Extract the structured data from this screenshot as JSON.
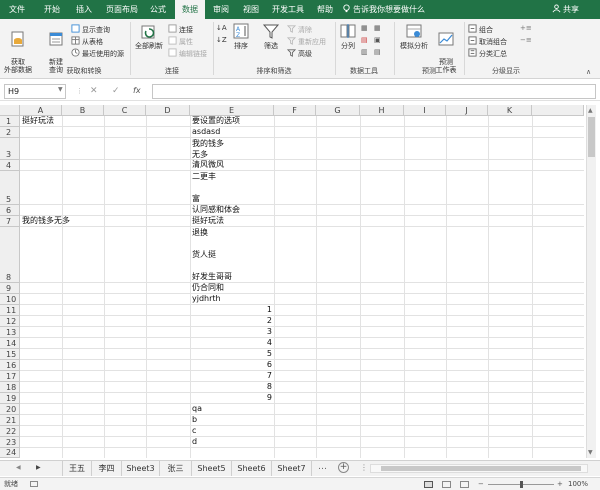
{
  "tabs": [
    "文件",
    "开始",
    "插入",
    "页面布局",
    "公式",
    "数据",
    "审阅",
    "视图",
    "开发工具",
    "帮助"
  ],
  "search_text": "告诉我你想要做什么",
  "share": "共享",
  "ribbon": {
    "get_external": "获取\n外部数据",
    "new_query": "新建\n查询",
    "show_queries": "显示查询",
    "from_table": "从表格",
    "recent_sources": "最近使用的源",
    "refresh_all": "全部刷新",
    "connections": "连接",
    "properties": "属性",
    "edit_links": "编辑链接",
    "sort": "排序",
    "filter": "筛选",
    "clear": "清除",
    "reapply": "重新应用",
    "advanced": "高级",
    "split": "分列",
    "whatif": "模拟分析",
    "forecast_sheet": "预测\n工作表",
    "group": "组合",
    "ungroup": "取消组合",
    "subtotal": "分类汇总",
    "groups": {
      "get_transform": "获取和转换",
      "connections": "连接",
      "sort_filter": "排序和筛选",
      "data_tools": "数据工具",
      "forecast": "预测",
      "outline": "分级显示"
    }
  },
  "name_box": "H9",
  "formula_icons": {
    "cancel": "✕",
    "enter": "✓",
    "fx": "fx"
  },
  "columns": [
    "A",
    "B",
    "C",
    "D",
    "E",
    "F",
    "G",
    "H",
    "I",
    "J",
    "K"
  ],
  "rows": [
    "1",
    "2",
    "3",
    "4",
    "5",
    "6",
    "7",
    "8",
    "9",
    "10",
    "11",
    "12",
    "13",
    "14",
    "15",
    "16",
    "17",
    "18",
    "19",
    "20",
    "21",
    "22",
    "23",
    "24"
  ],
  "cells": {
    "a1": "挺好玩法",
    "e1": "要设置的选项",
    "e2": "asdasd",
    "e3a": "我的钱多",
    "e3b": "无多",
    "e4": "清风微风",
    "e5a": "二更丰",
    "e5b": "富",
    "e6": "认同感和体会",
    "a7": "我的钱多无多",
    "e7": "挺好玩法",
    "e8a": "退换",
    "e8b": "货人挺",
    "e8c": "好发生哥哥",
    "e9": "仍合同和",
    "e10": "yjdhrth",
    "e11": "1",
    "e12": "2",
    "e13": "3",
    "e14": "4",
    "e15": "5",
    "e16": "6",
    "e17": "7",
    "e18": "8",
    "e19": "9",
    "e20": "qa",
    "e21": "b",
    "e22": "c",
    "e23": "d"
  },
  "sheets": [
    "王五",
    "李四",
    "Sheet3",
    "张三",
    "Sheet5",
    "Sheet6",
    "Sheet7"
  ],
  "status": {
    "ready": "就绪",
    "zoom": "100%"
  }
}
